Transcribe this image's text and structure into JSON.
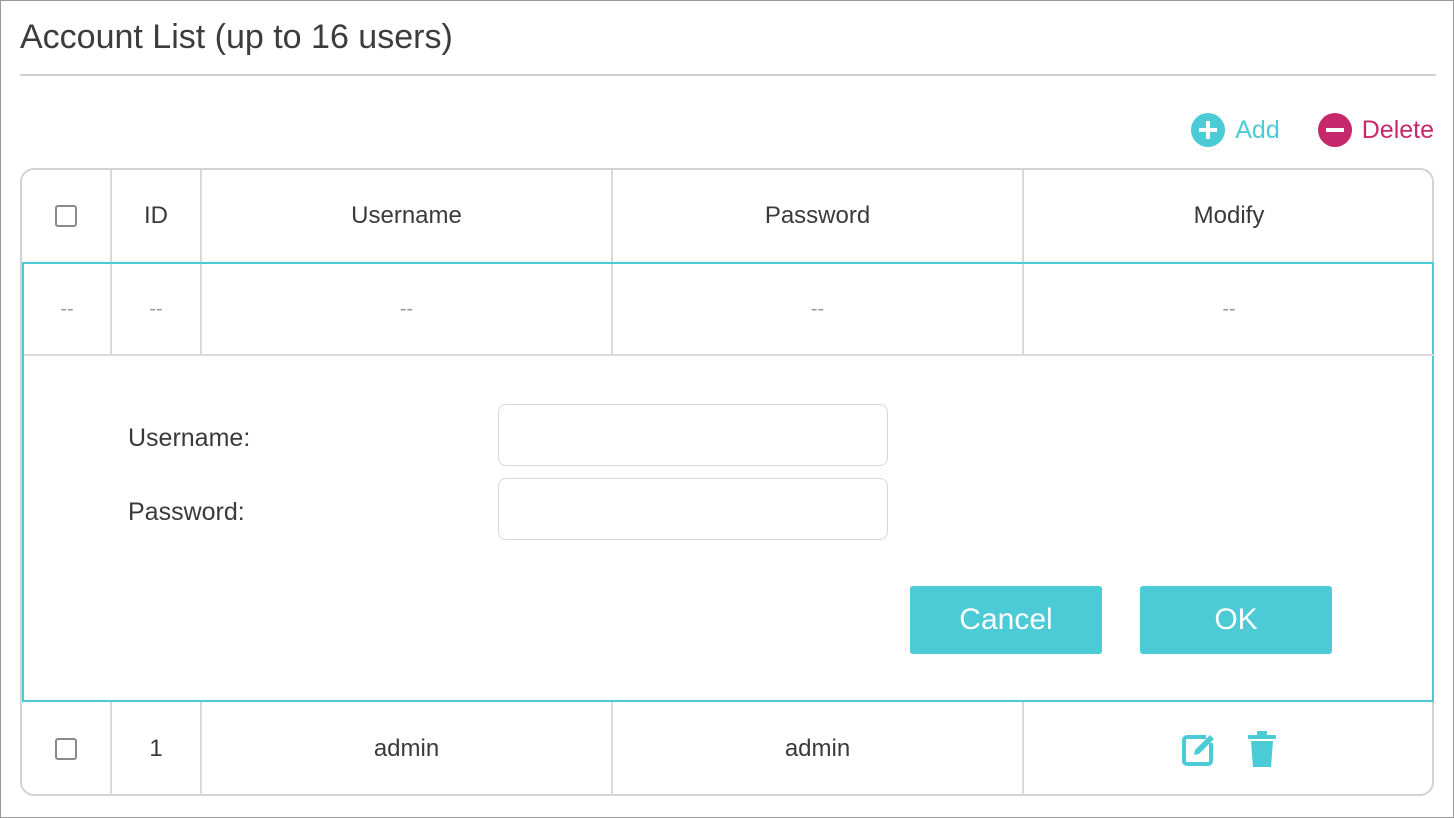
{
  "page": {
    "title": "Account List (up to 16 users)"
  },
  "toolbar": {
    "add_label": "Add",
    "delete_label": "Delete"
  },
  "colors": {
    "accent": "#4acbd6",
    "delete": "#c7286b",
    "border": "#d3d3d3"
  },
  "table": {
    "headers": {
      "id": "ID",
      "username": "Username",
      "password": "Password",
      "modify": "Modify"
    },
    "new_row": {
      "check": "--",
      "id": "--",
      "username": "--",
      "password": "--",
      "modify": "--"
    },
    "rows": [
      {
        "id": "1",
        "username": "admin",
        "password": "admin",
        "icons": [
          "edit-icon",
          "trash-icon"
        ]
      }
    ]
  },
  "form": {
    "username_label": "Username:",
    "password_label": "Password:",
    "username_value": "",
    "password_value": "",
    "cancel_label": "Cancel",
    "ok_label": "OK"
  }
}
